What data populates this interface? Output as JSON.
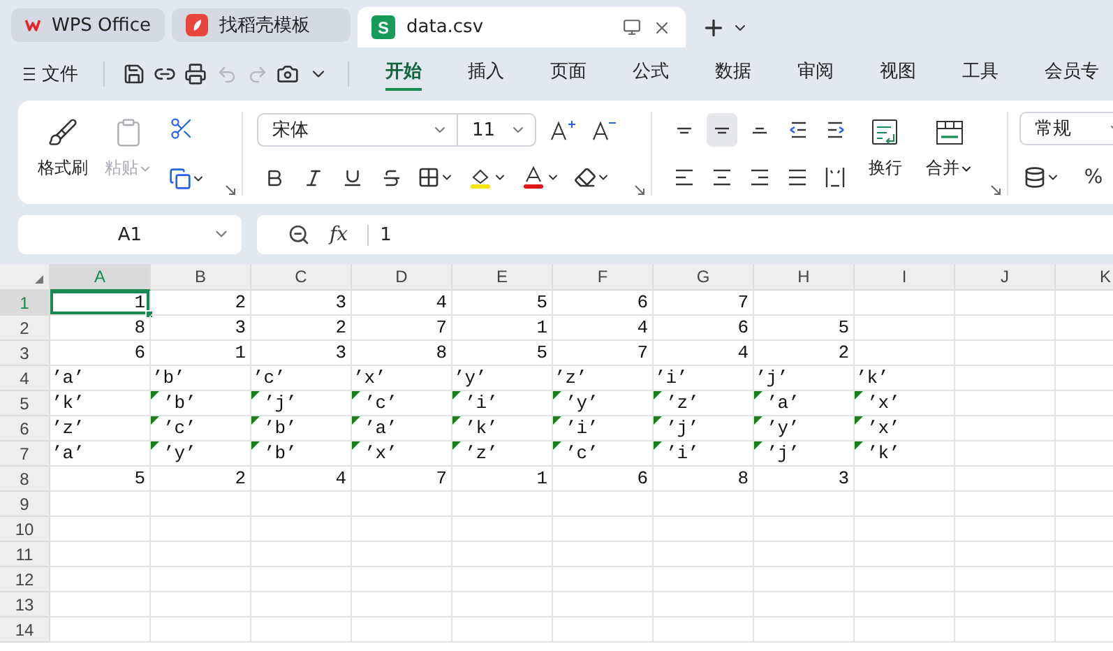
{
  "tabs": [
    {
      "label": "WPS Office",
      "kind": "wps",
      "selected": false
    },
    {
      "label": "找稻壳模板",
      "kind": "template",
      "selected": false
    },
    {
      "label": "data.csv",
      "kind": "sheet",
      "icon_letter": "S",
      "selected": true
    }
  ],
  "menu": {
    "file_label": "文件",
    "tabs": [
      {
        "label": "开始",
        "selected": true
      },
      {
        "label": "插入",
        "selected": false
      },
      {
        "label": "页面",
        "selected": false
      },
      {
        "label": "公式",
        "selected": false
      },
      {
        "label": "数据",
        "selected": false
      },
      {
        "label": "审阅",
        "selected": false
      },
      {
        "label": "视图",
        "selected": false
      },
      {
        "label": "工具",
        "selected": false
      },
      {
        "label": "会员专",
        "selected": false
      }
    ]
  },
  "ribbon": {
    "format_painter": "格式刷",
    "paste": {
      "label": "粘贴",
      "disabled": true
    },
    "font": "宋体",
    "font_size": "11",
    "align_top": [
      {
        "kind": "top",
        "selected": false
      },
      {
        "kind": "middle",
        "selected": true
      },
      {
        "kind": "bottom",
        "selected": false
      },
      {
        "kind": "outdent",
        "selected": false
      },
      {
        "kind": "indent",
        "selected": false
      }
    ],
    "align_bottom": [
      {
        "kind": "left",
        "selected": false
      },
      {
        "kind": "center",
        "selected": false
      },
      {
        "kind": "right",
        "selected": false
      },
      {
        "kind": "justify",
        "selected": false
      },
      {
        "kind": "distributed",
        "selected": false
      }
    ],
    "wrap": "换行",
    "merge": "合并",
    "number_format": "常规",
    "percent": "%"
  },
  "formula_bar": {
    "cell_ref": "A1",
    "function_symbol": "fx",
    "content": "1"
  },
  "grid": {
    "columns": [
      {
        "label": "A",
        "selected": true
      },
      {
        "label": "B",
        "selected": false
      },
      {
        "label": "C",
        "selected": false
      },
      {
        "label": "D",
        "selected": false
      },
      {
        "label": "E",
        "selected": false
      },
      {
        "label": "F",
        "selected": false
      },
      {
        "label": "G",
        "selected": false
      },
      {
        "label": "H",
        "selected": false
      },
      {
        "label": "I",
        "selected": false
      },
      {
        "label": "J",
        "selected": false
      },
      {
        "label": "K",
        "selected": false
      }
    ],
    "rows": [
      {
        "header": "1",
        "selected": true,
        "cells": [
          {
            "text": "1",
            "kind": "number"
          },
          {
            "text": "2",
            "kind": "number"
          },
          {
            "text": "3",
            "kind": "number"
          },
          {
            "text": "4",
            "kind": "number"
          },
          {
            "text": "5",
            "kind": "number"
          },
          {
            "text": "6",
            "kind": "number"
          },
          {
            "text": "7",
            "kind": "number"
          }
        ]
      },
      {
        "header": "2",
        "selected": false,
        "cells": [
          {
            "text": "8",
            "kind": "number"
          },
          {
            "text": "3",
            "kind": "number"
          },
          {
            "text": "2",
            "kind": "number"
          },
          {
            "text": "7",
            "kind": "number"
          },
          {
            "text": "1",
            "kind": "number"
          },
          {
            "text": "4",
            "kind": "number"
          },
          {
            "text": "6",
            "kind": "number"
          },
          {
            "text": "5",
            "kind": "number"
          }
        ]
      },
      {
        "header": "3",
        "selected": false,
        "cells": [
          {
            "text": "6",
            "kind": "number"
          },
          {
            "text": "1",
            "kind": "number"
          },
          {
            "text": "3",
            "kind": "number"
          },
          {
            "text": "8",
            "kind": "number"
          },
          {
            "text": "5",
            "kind": "number"
          },
          {
            "text": "7",
            "kind": "number"
          },
          {
            "text": "4",
            "kind": "number"
          },
          {
            "text": "2",
            "kind": "number"
          }
        ]
      },
      {
        "header": "4",
        "selected": false,
        "cells": [
          {
            "text": "’a’",
            "kind": "text",
            "flagged": false
          },
          {
            "text": "’b’",
            "kind": "text",
            "flagged": false
          },
          {
            "text": "’c’",
            "kind": "text",
            "flagged": false
          },
          {
            "text": "’x’",
            "kind": "text",
            "flagged": false
          },
          {
            "text": "’y’",
            "kind": "text",
            "flagged": false
          },
          {
            "text": "’z’",
            "kind": "text",
            "flagged": false
          },
          {
            "text": "’i’",
            "kind": "text",
            "flagged": false
          },
          {
            "text": "’j’",
            "kind": "text",
            "flagged": false
          },
          {
            "text": "’k’",
            "kind": "text",
            "flagged": false
          }
        ]
      },
      {
        "header": "5",
        "selected": false,
        "cells": [
          {
            "text": "’k’",
            "kind": "text",
            "flagged": false
          },
          {
            "text": "’b’",
            "kind": "text",
            "flagged": true
          },
          {
            "text": "’j’",
            "kind": "text",
            "flagged": true
          },
          {
            "text": "’c’",
            "kind": "text",
            "flagged": true
          },
          {
            "text": "’i’",
            "kind": "text",
            "flagged": true
          },
          {
            "text": "’y’",
            "kind": "text",
            "flagged": true
          },
          {
            "text": "’z’",
            "kind": "text",
            "flagged": true
          },
          {
            "text": "’a’",
            "kind": "text",
            "flagged": true
          },
          {
            "text": "’x’",
            "kind": "text",
            "flagged": true
          }
        ]
      },
      {
        "header": "6",
        "selected": false,
        "cells": [
          {
            "text": "’z’",
            "kind": "text",
            "flagged": false
          },
          {
            "text": "’c’",
            "kind": "text",
            "flagged": true
          },
          {
            "text": "’b’",
            "kind": "text",
            "flagged": true
          },
          {
            "text": "’a’",
            "kind": "text",
            "flagged": true
          },
          {
            "text": "’k’",
            "kind": "text",
            "flagged": true
          },
          {
            "text": "’i’",
            "kind": "text",
            "flagged": true
          },
          {
            "text": "’j’",
            "kind": "text",
            "flagged": true
          },
          {
            "text": "’y’",
            "kind": "text",
            "flagged": true
          },
          {
            "text": "’x’",
            "kind": "text",
            "flagged": true
          }
        ]
      },
      {
        "header": "7",
        "selected": false,
        "cells": [
          {
            "text": "’a’",
            "kind": "text",
            "flagged": false
          },
          {
            "text": "’y’",
            "kind": "text",
            "flagged": true
          },
          {
            "text": "’b’",
            "kind": "text",
            "flagged": true
          },
          {
            "text": "’x’",
            "kind": "text",
            "flagged": true
          },
          {
            "text": "’z’",
            "kind": "text",
            "flagged": true
          },
          {
            "text": "’c’",
            "kind": "text",
            "flagged": true
          },
          {
            "text": "’i’",
            "kind": "text",
            "flagged": true
          },
          {
            "text": "’j’",
            "kind": "text",
            "flagged": true
          },
          {
            "text": "’k’",
            "kind": "text",
            "flagged": true
          }
        ]
      },
      {
        "header": "8",
        "selected": false,
        "cells": [
          {
            "text": "5",
            "kind": "number"
          },
          {
            "text": "2",
            "kind": "number"
          },
          {
            "text": "4",
            "kind": "number"
          },
          {
            "text": "7",
            "kind": "number"
          },
          {
            "text": "1",
            "kind": "number"
          },
          {
            "text": "6",
            "kind": "number"
          },
          {
            "text": "8",
            "kind": "number"
          },
          {
            "text": "3",
            "kind": "number"
          }
        ]
      },
      {
        "header": "9",
        "selected": false,
        "cells": []
      },
      {
        "header": "10",
        "selected": false,
        "cells": []
      },
      {
        "header": "11",
        "selected": false,
        "cells": []
      },
      {
        "header": "12",
        "selected": false,
        "cells": []
      },
      {
        "header": "13",
        "selected": false,
        "cells": []
      },
      {
        "header": "14",
        "selected": false,
        "cells": []
      }
    ]
  }
}
